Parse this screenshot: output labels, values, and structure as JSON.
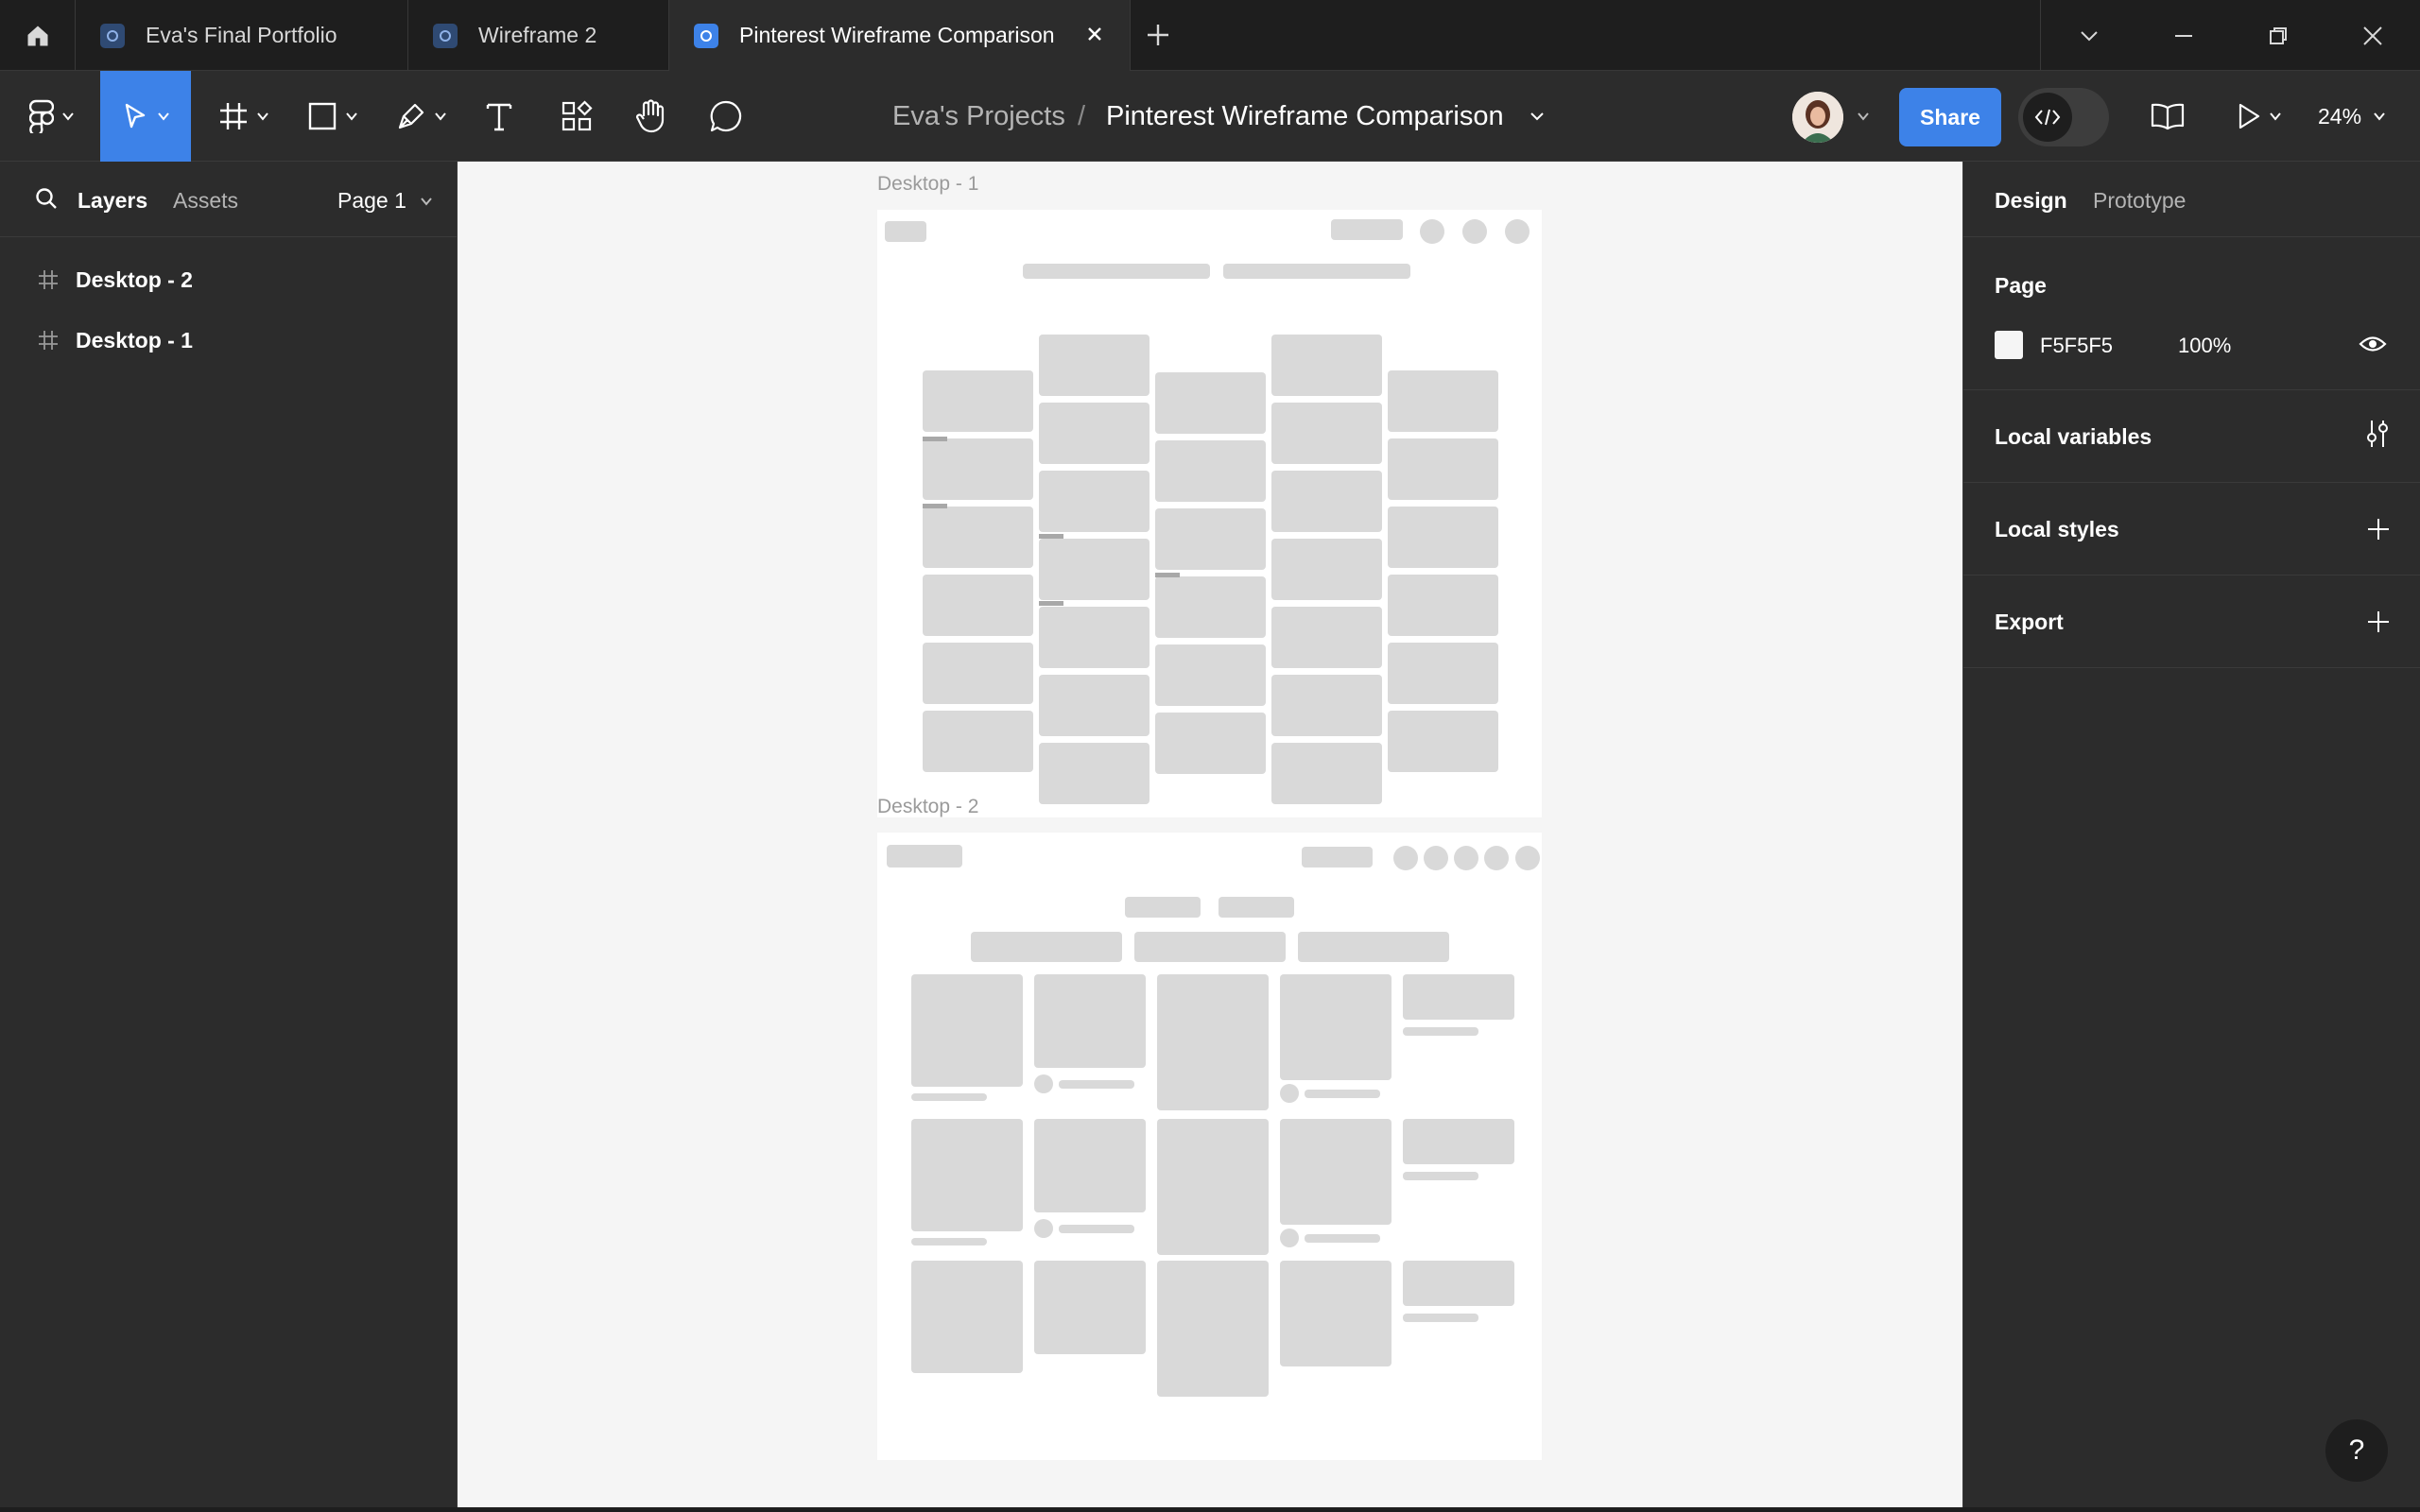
{
  "tabs": [
    {
      "label": "Eva's Final Portfolio",
      "active": false
    },
    {
      "label": "Wireframe 2",
      "active": false
    },
    {
      "label": "Pinterest Wireframe Comparison",
      "active": true
    }
  ],
  "toolbar": {
    "tools": [
      "main-menu",
      "move",
      "frame",
      "shape",
      "pen",
      "text",
      "components",
      "hand",
      "comment"
    ],
    "breadcrumb_project": "Eva's Projects",
    "breadcrumb_separator": "/",
    "file_name": "Pinterest Wireframe Comparison",
    "share_label": "Share",
    "zoom": "24%"
  },
  "left_panel": {
    "tab_layers": "Layers",
    "tab_assets": "Assets",
    "page_selector": "Page 1",
    "layers": [
      {
        "label": "Desktop - 2"
      },
      {
        "label": "Desktop - 1"
      }
    ]
  },
  "canvas": {
    "frame1_label": "Desktop - 1",
    "frame2_label": "Desktop - 2"
  },
  "right_panel": {
    "tab_design": "Design",
    "tab_prototype": "Prototype",
    "page_title": "Page",
    "page_color": "F5F5F5",
    "page_opacity": "100%",
    "local_variables": "Local variables",
    "local_styles": "Local styles",
    "export": "Export"
  },
  "help": "?",
  "colors": {
    "accent": "#3d82e8",
    "canvas_bg": "#f5f5f5",
    "panel_bg": "#2c2c2c",
    "tabbar_bg": "#1e1e1e",
    "placeholder": "#d9d9d9"
  }
}
